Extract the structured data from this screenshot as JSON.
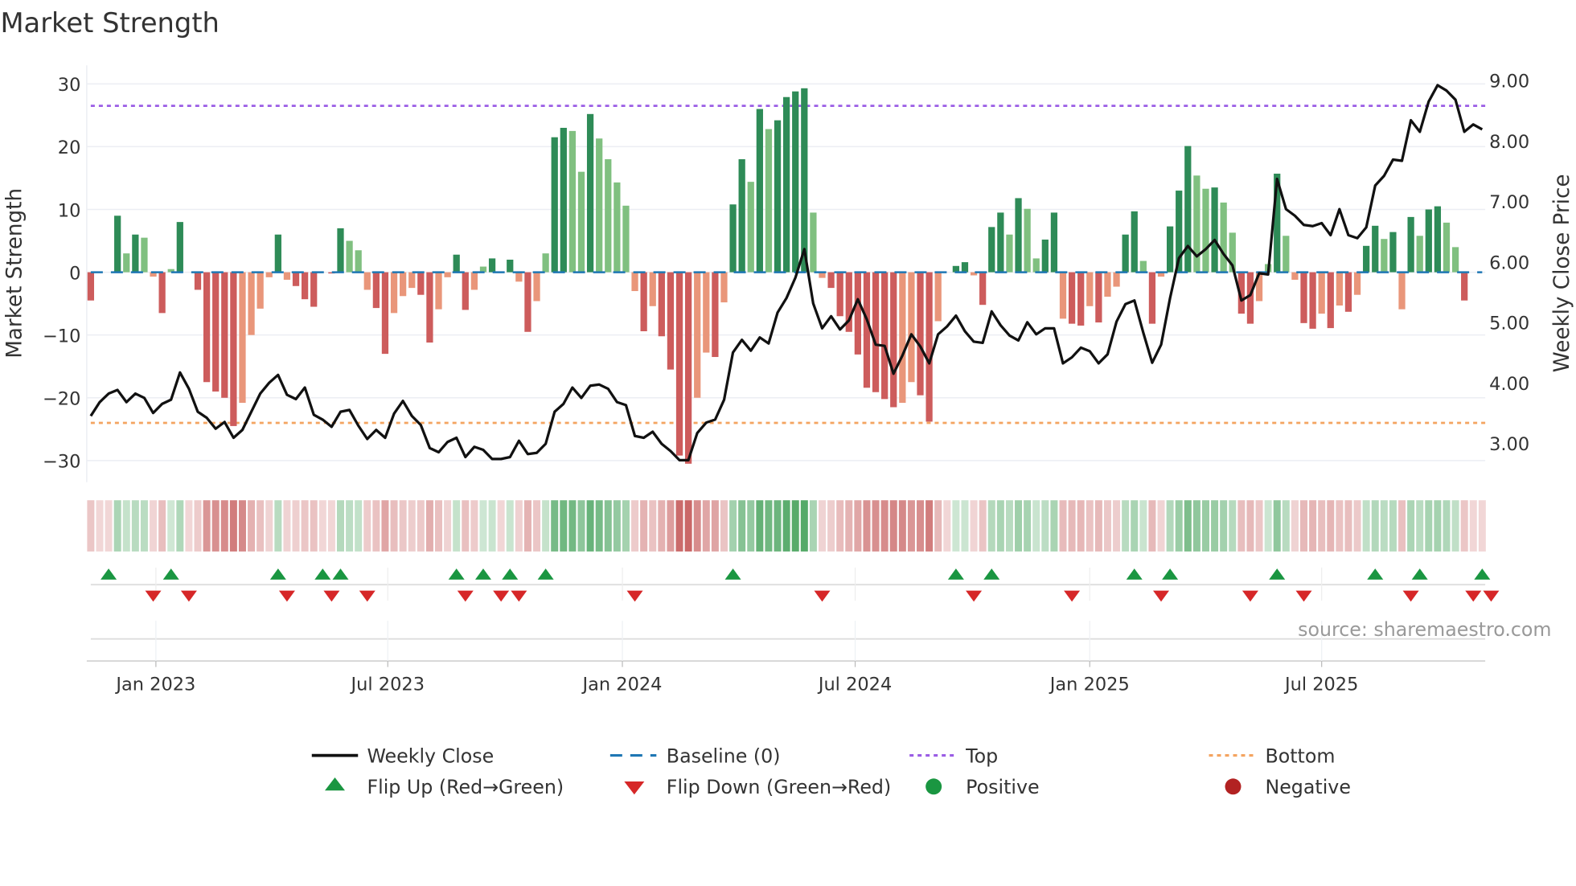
{
  "chart_data": {
    "type": "bar",
    "title": "Market Strength",
    "ylabel": "Market Strength",
    "y2label": "Weekly Close Price",
    "ylim": [
      -33,
      33
    ],
    "y2lim": [
      2.65,
      9.25
    ],
    "yticks": [
      30,
      20,
      10,
      0,
      -10,
      -20,
      -30
    ],
    "yticklabels": [
      "30",
      "20",
      "10",
      "0",
      "−10",
      "−20",
      "−30"
    ],
    "y2ticks": [
      9,
      8,
      7,
      6,
      5,
      4,
      3
    ],
    "y2ticklabels": [
      "9.00",
      "8.00",
      "7.00",
      "6.00",
      "5.00",
      "4.00",
      "3.00"
    ],
    "xticklabels": [
      "Jan 2023",
      "Jul 2023",
      "Jan 2024",
      "Jul 2024",
      "Jan 2025",
      "Jul 2025"
    ],
    "xtick_week_index": [
      7.3,
      33.3,
      59.6,
      85.7,
      112,
      138
    ],
    "top_level": 26.5,
    "bottom_level": -24,
    "baseline": 0,
    "source": "source: sharemaestro.com",
    "strength": [
      -4.5,
      0,
      0,
      9,
      3,
      6,
      5.5,
      -0.7,
      -6.5,
      0.5,
      8,
      0,
      -2.8,
      -17.5,
      -19,
      -20,
      -24.5,
      -20.8,
      -10,
      -5.8,
      -0.8,
      6,
      -1.2,
      -2.2,
      -4.3,
      -5.5,
      0,
      -0.2,
      7,
      5,
      3.5,
      -2.8,
      -5.7,
      -13,
      -6.5,
      -3.8,
      -2.5,
      -3.6,
      -11.2,
      -5.9,
      -0.8,
      2.8,
      -6,
      -2.8,
      0.9,
      2.2,
      0,
      2,
      -1.5,
      -9.5,
      -4.6,
      3,
      21.5,
      23,
      22.5,
      16,
      25.2,
      21.3,
      18,
      14.3,
      10.6,
      -3,
      -9.4,
      -5.4,
      -10.2,
      -15.5,
      -29.2,
      -30.5,
      -20,
      -12.8,
      -13.5,
      -4.8,
      10.8,
      18,
      14.4,
      26,
      22.8,
      24.2,
      27.9,
      28.8,
      29.3,
      9.5,
      -0.9,
      -2.5,
      -7,
      -9.5,
      -13.1,
      -18.4,
      -19.1,
      -20.2,
      -21.5,
      -20.8,
      -17.5,
      -19.6,
      -23.8,
      -7.8,
      0,
      1,
      1.6,
      -0.5,
      -5.2,
      7.2,
      9.5,
      6,
      11.8,
      10.1,
      2.2,
      5.2,
      9.5,
      -7.4,
      -8.2,
      -8.5,
      -5.4,
      -8,
      -3.9,
      -2.3,
      6,
      9.7,
      1.8,
      -8.2,
      -0.7,
      7.3,
      13,
      20.1,
      15.4,
      13.3,
      13.5,
      11.1,
      6.3,
      -6.6,
      -8.2,
      -4.6,
      1.3,
      15.7,
      5.8,
      -1.2,
      -8.1,
      -9,
      -6.6,
      -8.9,
      -5.3,
      -6.3,
      -3.6,
      4.2,
      7.4,
      5.3,
      6.4,
      -5.9,
      8.8,
      5.8,
      10,
      10.5,
      7.9,
      4,
      -4.5,
      0,
      0
    ],
    "weekly_close": [
      3.45,
      3.68,
      3.82,
      3.88,
      3.68,
      3.82,
      3.75,
      3.5,
      3.65,
      3.72,
      4.17,
      3.9,
      3.52,
      3.42,
      3.24,
      3.35,
      3.09,
      3.22,
      3.52,
      3.82,
      4.0,
      4.13,
      3.8,
      3.73,
      3.92,
      3.47,
      3.39,
      3.27,
      3.52,
      3.55,
      3.29,
      3.07,
      3.22,
      3.09,
      3.49,
      3.7,
      3.45,
      3.3,
      2.92,
      2.85,
      3.02,
      3.09,
      2.77,
      2.94,
      2.89,
      2.74,
      2.74,
      2.77,
      3.04,
      2.82,
      2.84,
      2.99,
      3.52,
      3.65,
      3.92,
      3.75,
      3.95,
      3.97,
      3.9,
      3.68,
      3.63,
      3.12,
      3.09,
      3.19,
      2.99,
      2.87,
      2.72,
      2.72,
      3.17,
      3.34,
      3.39,
      3.72,
      4.5,
      4.71,
      4.53,
      4.75,
      4.65,
      5.16,
      5.4,
      5.74,
      6.21,
      5.31,
      4.9,
      5.1,
      4.88,
      5.03,
      5.38,
      5.05,
      4.63,
      4.61,
      4.15,
      4.45,
      4.8,
      4.6,
      4.32,
      4.8,
      4.93,
      5.11,
      4.85,
      4.68,
      4.66,
      5.18,
      4.95,
      4.78,
      4.7,
      5.0,
      4.8,
      4.9,
      4.9,
      4.32,
      4.42,
      4.58,
      4.52,
      4.32,
      4.47,
      5.01,
      5.3,
      5.36,
      4.83,
      4.33,
      4.63,
      5.4,
      6.06,
      6.26,
      6.09,
      6.21,
      6.36,
      6.13,
      5.94,
      5.36,
      5.45,
      5.81,
      5.79,
      7.37,
      6.87,
      6.76,
      6.61,
      6.59,
      6.64,
      6.44,
      6.87,
      6.44,
      6.39,
      6.57,
      7.26,
      7.42,
      7.69,
      7.67,
      8.34,
      8.15,
      8.65,
      8.92,
      8.83,
      8.68,
      8.15,
      8.27,
      8.19
    ],
    "flip_up_week_index": [
      2,
      9,
      21,
      26,
      28,
      41,
      44,
      47,
      51,
      72,
      97,
      101,
      117,
      121,
      133,
      144,
      149,
      156
    ],
    "flip_down_week_index": [
      7,
      11,
      22,
      27,
      31,
      42,
      46,
      48,
      61,
      82,
      99,
      110,
      120,
      130,
      136,
      148,
      155,
      157
    ],
    "legend": {
      "weekly_close": "Weekly Close",
      "baseline": "Baseline (0)",
      "top": "Top",
      "bottom": "Bottom",
      "flip_up": "Flip Up (Red→Green)",
      "flip_down": "Flip Down (Green→Red)",
      "positive": "Positive",
      "negative": "Negative"
    },
    "legend_placement": "bottom",
    "grid": true,
    "colors": {
      "pos_strong": "#2e8b57",
      "pos_weak": "#80c080",
      "neg_strong": "#cd5c5c",
      "neg_weak": "#e9967a",
      "line": "#111111",
      "baseline": "#1f77b4",
      "top": "#9b5de5",
      "bottom": "#f4a460",
      "flip_up": "#1a9641",
      "flip_down": "#d62728",
      "positive": "#1a9641",
      "negative": "#b22222"
    }
  }
}
